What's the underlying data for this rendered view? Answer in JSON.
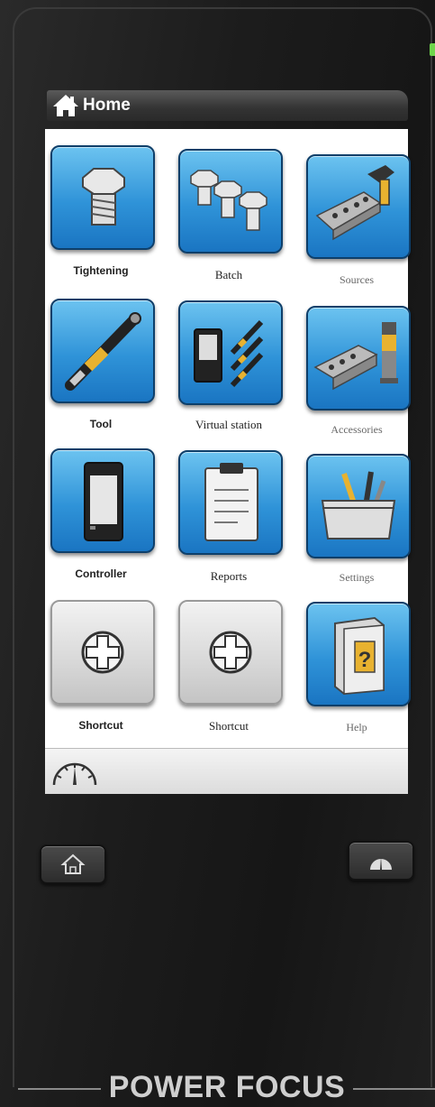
{
  "header": {
    "title": "Home"
  },
  "tiles": [
    {
      "label": "Tightening",
      "icon": "bolt-icon"
    },
    {
      "label": "Batch",
      "icon": "bolts-icon"
    },
    {
      "label": "Sources",
      "icon": "barcode-scanner-icon"
    },
    {
      "label": "Tool",
      "icon": "nutrunner-tool-icon"
    },
    {
      "label": "Virtual station",
      "icon": "virtual-station-icon"
    },
    {
      "label": "Accessories",
      "icon": "accessories-icon"
    },
    {
      "label": "Controller",
      "icon": "controller-icon"
    },
    {
      "label": "Reports",
      "icon": "clipboard-icon"
    },
    {
      "label": "Settings",
      "icon": "toolbox-icon"
    },
    {
      "label": "Shortcut",
      "icon": "add-shortcut-icon"
    },
    {
      "label": "Shortcut",
      "icon": "add-shortcut-icon"
    },
    {
      "label": "Help",
      "icon": "help-book-icon"
    }
  ],
  "status_bar": {
    "icon": "gauge-icon"
  },
  "hardware_buttons": {
    "left_icon": "home-icon",
    "right_icon": "gauge-icon"
  },
  "brand": "POWER FOCUS",
  "colors": {
    "tile_blue": "#2f93d8",
    "led_green": "#6fd64c"
  }
}
